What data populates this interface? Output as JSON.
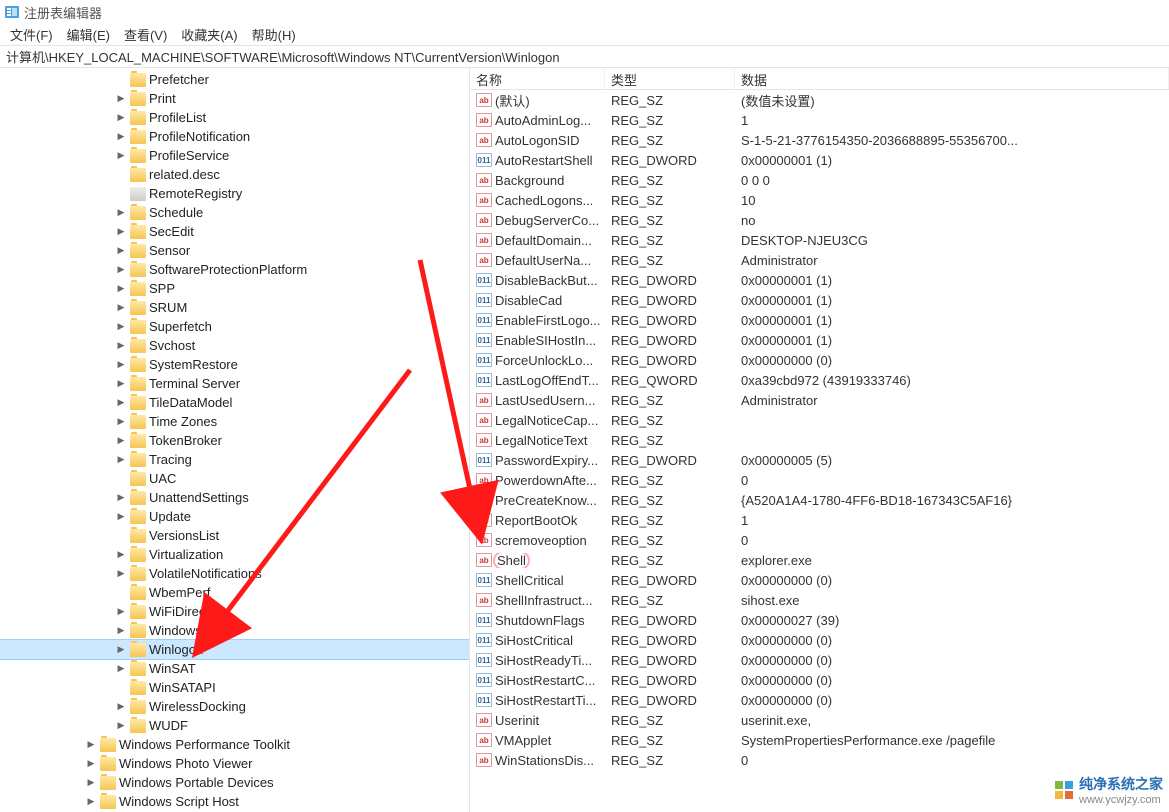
{
  "title": "注册表编辑器",
  "menu": {
    "file": "文件(F)",
    "edit": "编辑(E)",
    "view": "查看(V)",
    "favorites": "收藏夹(A)",
    "help": "帮助(H)"
  },
  "address": "计算机\\HKEY_LOCAL_MACHINE\\SOFTWARE\\Microsoft\\Windows NT\\CurrentVersion\\Winlogon",
  "columns": {
    "name": "名称",
    "type": "类型",
    "data": "数据"
  },
  "tree": [
    {
      "indent": 115,
      "exp": "",
      "icon": "y",
      "label": "Prefetcher"
    },
    {
      "indent": 115,
      "exp": ">",
      "icon": "y",
      "label": "Print"
    },
    {
      "indent": 115,
      "exp": ">",
      "icon": "y",
      "label": "ProfileList"
    },
    {
      "indent": 115,
      "exp": ">",
      "icon": "y",
      "label": "ProfileNotification"
    },
    {
      "indent": 115,
      "exp": ">",
      "icon": "y",
      "label": "ProfileService"
    },
    {
      "indent": 115,
      "exp": "",
      "icon": "y",
      "label": "related.desc"
    },
    {
      "indent": 115,
      "exp": "",
      "icon": "g",
      "label": "RemoteRegistry"
    },
    {
      "indent": 115,
      "exp": ">",
      "icon": "y",
      "label": "Schedule"
    },
    {
      "indent": 115,
      "exp": ">",
      "icon": "y",
      "label": "SecEdit"
    },
    {
      "indent": 115,
      "exp": ">",
      "icon": "y",
      "label": "Sensor"
    },
    {
      "indent": 115,
      "exp": ">",
      "icon": "y",
      "label": "SoftwareProtectionPlatform"
    },
    {
      "indent": 115,
      "exp": ">",
      "icon": "y",
      "label": "SPP"
    },
    {
      "indent": 115,
      "exp": ">",
      "icon": "y",
      "label": "SRUM"
    },
    {
      "indent": 115,
      "exp": ">",
      "icon": "y",
      "label": "Superfetch"
    },
    {
      "indent": 115,
      "exp": ">",
      "icon": "y",
      "label": "Svchost"
    },
    {
      "indent": 115,
      "exp": ">",
      "icon": "y",
      "label": "SystemRestore"
    },
    {
      "indent": 115,
      "exp": ">",
      "icon": "y",
      "label": "Terminal Server"
    },
    {
      "indent": 115,
      "exp": ">",
      "icon": "y",
      "label": "TileDataModel"
    },
    {
      "indent": 115,
      "exp": ">",
      "icon": "y",
      "label": "Time Zones"
    },
    {
      "indent": 115,
      "exp": ">",
      "icon": "y",
      "label": "TokenBroker"
    },
    {
      "indent": 115,
      "exp": ">",
      "icon": "y",
      "label": "Tracing"
    },
    {
      "indent": 115,
      "exp": "",
      "icon": "y",
      "label": "UAC"
    },
    {
      "indent": 115,
      "exp": ">",
      "icon": "y",
      "label": "UnattendSettings"
    },
    {
      "indent": 115,
      "exp": ">",
      "icon": "y",
      "label": "Update"
    },
    {
      "indent": 115,
      "exp": "",
      "icon": "y",
      "label": "VersionsList"
    },
    {
      "indent": 115,
      "exp": ">",
      "icon": "y",
      "label": "Virtualization"
    },
    {
      "indent": 115,
      "exp": ">",
      "icon": "y",
      "label": "VolatileNotifications"
    },
    {
      "indent": 115,
      "exp": "",
      "icon": "y",
      "label": "WbemPerf"
    },
    {
      "indent": 115,
      "exp": ">",
      "icon": "y",
      "label": "WiFiDirectAPI"
    },
    {
      "indent": 115,
      "exp": ">",
      "icon": "y",
      "label": "Windows"
    },
    {
      "indent": 115,
      "exp": ">",
      "icon": "y",
      "label": "Winlogon",
      "sel": true
    },
    {
      "indent": 115,
      "exp": ">",
      "icon": "y",
      "label": "WinSAT"
    },
    {
      "indent": 115,
      "exp": "",
      "icon": "y",
      "label": "WinSATAPI"
    },
    {
      "indent": 115,
      "exp": ">",
      "icon": "y",
      "label": "WirelessDocking"
    },
    {
      "indent": 115,
      "exp": ">",
      "icon": "y",
      "label": "WUDF"
    },
    {
      "indent": 85,
      "exp": ">",
      "icon": "y",
      "label": "Windows Performance Toolkit"
    },
    {
      "indent": 85,
      "exp": ">",
      "icon": "y",
      "label": "Windows Photo Viewer"
    },
    {
      "indent": 85,
      "exp": ">",
      "icon": "y",
      "label": "Windows Portable Devices"
    },
    {
      "indent": 85,
      "exp": ">",
      "icon": "y",
      "label": "Windows Script Host"
    }
  ],
  "values": [
    {
      "i": "s",
      "n": "(默认)",
      "t": "REG_SZ",
      "d": "(数值未设置)"
    },
    {
      "i": "s",
      "n": "AutoAdminLog...",
      "t": "REG_SZ",
      "d": "1"
    },
    {
      "i": "s",
      "n": "AutoLogonSID",
      "t": "REG_SZ",
      "d": "S-1-5-21-3776154350-2036688895-55356700..."
    },
    {
      "i": "b",
      "n": "AutoRestartShell",
      "t": "REG_DWORD",
      "d": "0x00000001 (1)"
    },
    {
      "i": "s",
      "n": "Background",
      "t": "REG_SZ",
      "d": "0 0 0"
    },
    {
      "i": "s",
      "n": "CachedLogons...",
      "t": "REG_SZ",
      "d": "10"
    },
    {
      "i": "s",
      "n": "DebugServerCo...",
      "t": "REG_SZ",
      "d": "no"
    },
    {
      "i": "s",
      "n": "DefaultDomain...",
      "t": "REG_SZ",
      "d": "DESKTOP-NJEU3CG"
    },
    {
      "i": "s",
      "n": "DefaultUserNa...",
      "t": "REG_SZ",
      "d": "Administrator"
    },
    {
      "i": "b",
      "n": "DisableBackBut...",
      "t": "REG_DWORD",
      "d": "0x00000001 (1)"
    },
    {
      "i": "b",
      "n": "DisableCad",
      "t": "REG_DWORD",
      "d": "0x00000001 (1)"
    },
    {
      "i": "b",
      "n": "EnableFirstLogo...",
      "t": "REG_DWORD",
      "d": "0x00000001 (1)"
    },
    {
      "i": "b",
      "n": "EnableSIHostIn...",
      "t": "REG_DWORD",
      "d": "0x00000001 (1)"
    },
    {
      "i": "b",
      "n": "ForceUnlockLo...",
      "t": "REG_DWORD",
      "d": "0x00000000 (0)"
    },
    {
      "i": "b",
      "n": "LastLogOffEndT...",
      "t": "REG_QWORD",
      "d": "0xa39cbd972 (43919333746)"
    },
    {
      "i": "s",
      "n": "LastUsedUsern...",
      "t": "REG_SZ",
      "d": "Administrator"
    },
    {
      "i": "s",
      "n": "LegalNoticeCap...",
      "t": "REG_SZ",
      "d": ""
    },
    {
      "i": "s",
      "n": "LegalNoticeText",
      "t": "REG_SZ",
      "d": ""
    },
    {
      "i": "b",
      "n": "PasswordExpiry...",
      "t": "REG_DWORD",
      "d": "0x00000005 (5)"
    },
    {
      "i": "s",
      "n": "PowerdownAfte...",
      "t": "REG_SZ",
      "d": "0"
    },
    {
      "i": "s",
      "n": "PreCreateKnow...",
      "t": "REG_SZ",
      "d": "{A520A1A4-1780-4FF6-BD18-167343C5AF16}"
    },
    {
      "i": "s",
      "n": "ReportBootOk",
      "t": "REG_SZ",
      "d": "1"
    },
    {
      "i": "s",
      "n": "scremoveoption",
      "t": "REG_SZ",
      "d": "0"
    },
    {
      "i": "s",
      "n": "Shell",
      "t": "REG_SZ",
      "d": "explorer.exe",
      "hl": true
    },
    {
      "i": "b",
      "n": "ShellCritical",
      "t": "REG_DWORD",
      "d": "0x00000000 (0)"
    },
    {
      "i": "s",
      "n": "ShellInfrastruct...",
      "t": "REG_SZ",
      "d": "sihost.exe"
    },
    {
      "i": "b",
      "n": "ShutdownFlags",
      "t": "REG_DWORD",
      "d": "0x00000027 (39)"
    },
    {
      "i": "b",
      "n": "SiHostCritical",
      "t": "REG_DWORD",
      "d": "0x00000000 (0)"
    },
    {
      "i": "b",
      "n": "SiHostReadyTi...",
      "t": "REG_DWORD",
      "d": "0x00000000 (0)"
    },
    {
      "i": "b",
      "n": "SiHostRestartC...",
      "t": "REG_DWORD",
      "d": "0x00000000 (0)"
    },
    {
      "i": "b",
      "n": "SiHostRestartTi...",
      "t": "REG_DWORD",
      "d": "0x00000000 (0)"
    },
    {
      "i": "s",
      "n": "Userinit",
      "t": "REG_SZ",
      "d": "userinit.exe,"
    },
    {
      "i": "s",
      "n": "VMApplet",
      "t": "REG_SZ",
      "d": "SystemPropertiesPerformance.exe /pagefile"
    },
    {
      "i": "s",
      "n": "WinStationsDis...",
      "t": "REG_SZ",
      "d": "0"
    }
  ],
  "watermark": {
    "title": "纯净系统之家",
    "url": "www.ycwjzy.com"
  }
}
